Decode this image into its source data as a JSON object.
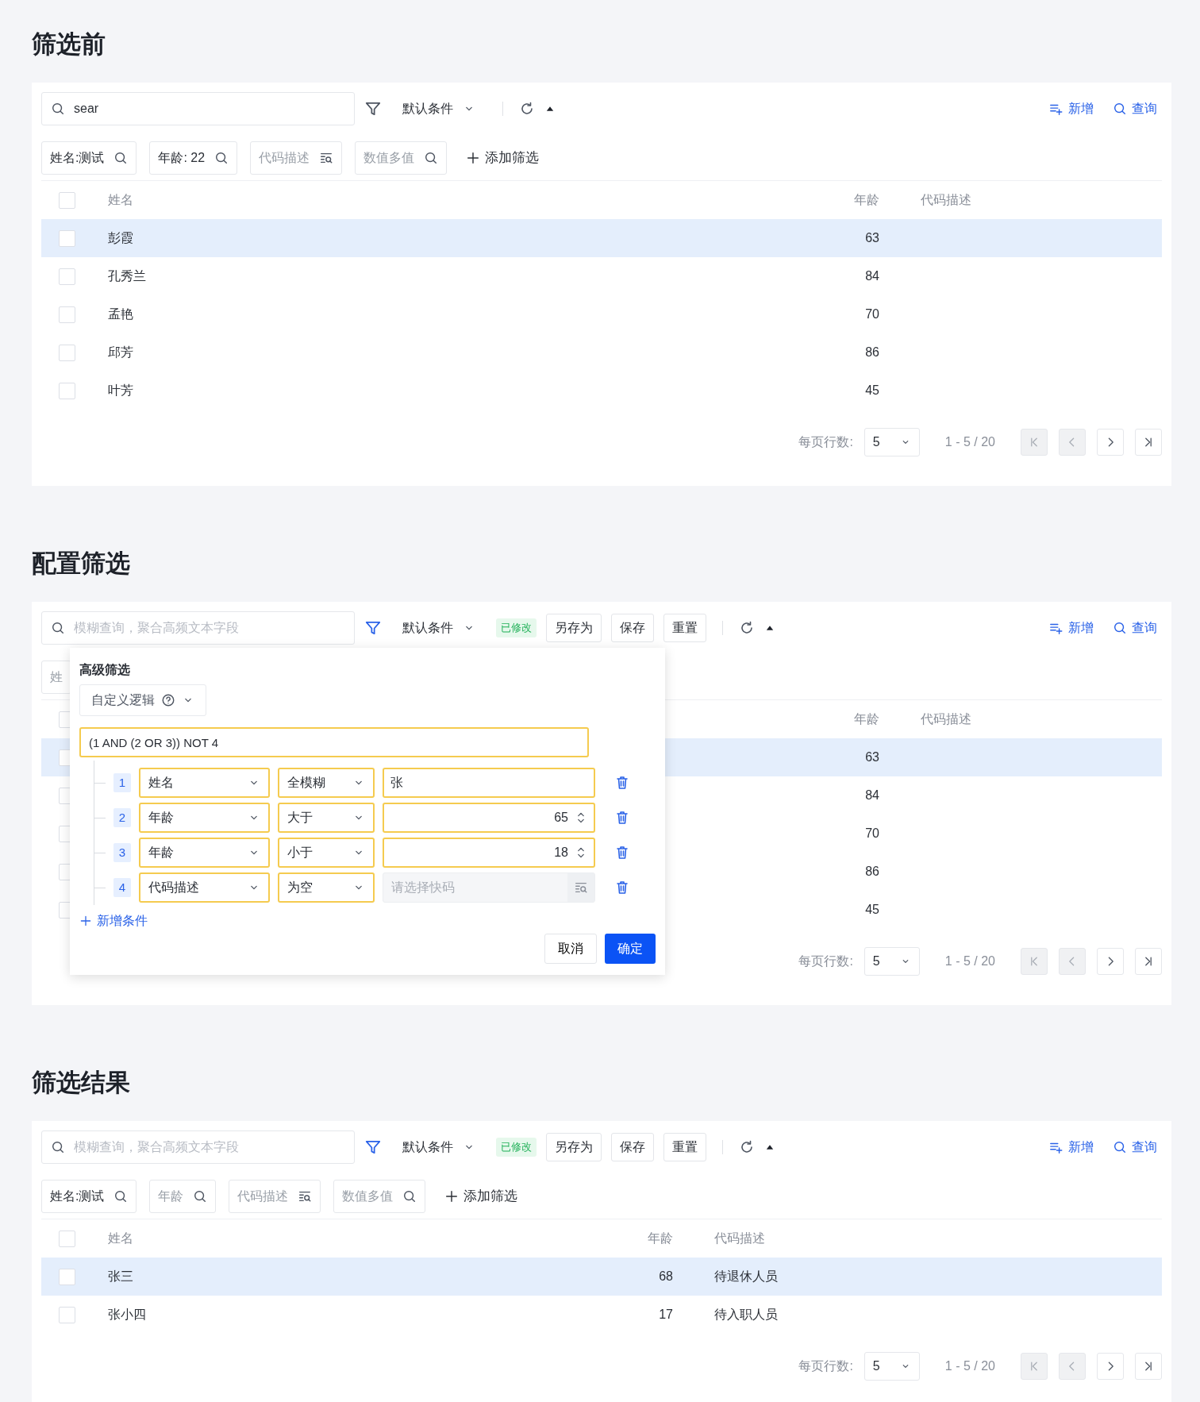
{
  "sections": [
    {
      "title": "筛选前",
      "toolbar": {
        "search": {
          "value": "sear"
        },
        "filter_active": false,
        "condition": "默认条件",
        "actions": [
          {
            "kind": "add",
            "label": "新增"
          },
          {
            "kind": "query",
            "label": "查询"
          }
        ]
      },
      "chips": [
        {
          "text": "姓名:测试",
          "filled": true,
          "kind": "search"
        },
        {
          "text": "年龄: 22",
          "filled": true,
          "kind": "search"
        },
        {
          "text": "代码描述",
          "filled": false,
          "kind": "lookup"
        },
        {
          "text": "数值多值",
          "filled": false,
          "kind": "search"
        }
      ],
      "add_filter": "添加筛选",
      "table": {
        "columns": [
          {
            "kind": "name",
            "label": "姓名"
          },
          {
            "kind": "age",
            "label": "年龄"
          },
          {
            "kind": "desc",
            "label": "代码描述"
          }
        ],
        "all_checked": false,
        "rows": [
          {
            "name": "彭霞",
            "age": "63",
            "selected": true,
            "checked": false
          },
          {
            "name": "孔秀兰",
            "age": "84",
            "selected": false,
            "checked": false
          },
          {
            "name": "孟艳",
            "age": "70",
            "selected": false,
            "checked": false
          },
          {
            "name": "邱芳",
            "age": "86",
            "selected": false,
            "checked": false
          },
          {
            "name": "叶芳",
            "age": "45",
            "selected": false,
            "checked": false
          }
        ]
      },
      "pagination": {
        "rows_label": "每页行数:",
        "page_size": "5",
        "range": "1 - 5 / 20",
        "nav": [
          {
            "kind": "first",
            "disabled": true
          },
          {
            "kind": "prev",
            "disabled": true
          },
          {
            "kind": "next",
            "disabled": false
          },
          {
            "kind": "last",
            "disabled": false
          }
        ]
      }
    },
    {
      "title": "配置筛选",
      "toolbar": {
        "search": {
          "placeholder": "模糊查询，聚合高频文本字段"
        },
        "filter_active": true,
        "condition": "默认条件",
        "modified_tag": "已修改",
        "buttons": [
          "另存为",
          "保存",
          "重置"
        ],
        "actions": [
          {
            "kind": "add",
            "label": "新增"
          },
          {
            "kind": "query",
            "label": "查询"
          }
        ]
      },
      "chips": [
        {
          "text": "姓",
          "filled": false
        }
      ],
      "table": {
        "columns": [
          {
            "kind": "age",
            "label": "年龄"
          },
          {
            "kind": "desc",
            "label": "代码描述"
          }
        ],
        "all_checked": false,
        "rows": [
          {
            "age": "63",
            "selected": true,
            "checked": false
          },
          {
            "age": "84",
            "selected": false,
            "checked": false
          },
          {
            "age": "70",
            "selected": false,
            "checked": false
          },
          {
            "age": "86",
            "selected": false,
            "checked": false
          },
          {
            "age": "45",
            "selected": false,
            "checked": false
          }
        ]
      },
      "pagination": {
        "rows_label": "每页行数:",
        "page_size": "5",
        "range": "1 - 5 / 20",
        "nav": [
          {
            "kind": "first",
            "disabled": true
          },
          {
            "kind": "prev",
            "disabled": true
          },
          {
            "kind": "next",
            "disabled": false
          },
          {
            "kind": "last",
            "disabled": false
          }
        ]
      },
      "advanced_filter": {
        "title": "高级筛选",
        "logic_mode": "自定义逻辑",
        "expression": "(1 AND (2 OR 3)) NOT 4",
        "conditions": [
          {
            "index": "1",
            "field": "姓名",
            "operator": "全模糊",
            "kind": "text",
            "value": "张"
          },
          {
            "index": "2",
            "field": "年龄",
            "operator": "大于",
            "kind": "number",
            "value": "65"
          },
          {
            "index": "3",
            "field": "年龄",
            "operator": "小于",
            "kind": "number",
            "value": "18"
          },
          {
            "index": "4",
            "field": "代码描述",
            "operator": "为空",
            "kind": "lookup",
            "placeholder": "请选择快码"
          }
        ],
        "add_condition": "新增条件",
        "buttons": [
          {
            "kind": "cancel",
            "label": "取消"
          },
          {
            "kind": "confirm",
            "label": "确定"
          }
        ]
      }
    },
    {
      "title": "筛选结果",
      "toolbar": {
        "search": {
          "placeholder": "模糊查询，聚合高频文本字段"
        },
        "filter_active": true,
        "condition": "默认条件",
        "modified_tag": "已修改",
        "buttons": [
          "另存为",
          "保存",
          "重置"
        ],
        "actions": [
          {
            "kind": "add",
            "label": "新增"
          },
          {
            "kind": "query",
            "label": "查询"
          }
        ]
      },
      "chips": [
        {
          "text": "姓名:测试",
          "filled": true,
          "kind": "search"
        },
        {
          "text": "年龄",
          "filled": false,
          "kind": "search"
        },
        {
          "text": "代码描述",
          "filled": false,
          "kind": "lookup"
        },
        {
          "text": "数值多值",
          "filled": false,
          "kind": "search"
        }
      ],
      "add_filter": "添加筛选",
      "table": {
        "columns": [
          {
            "kind": "name",
            "label": "姓名"
          },
          {
            "kind": "age",
            "label": "年龄"
          },
          {
            "kind": "desc",
            "label": "代码描述"
          }
        ],
        "all_checked": false,
        "rows": [
          {
            "name": "张三",
            "age": "68",
            "desc": "待退休人员",
            "selected": true,
            "checked": false
          },
          {
            "name": "张小四",
            "age": "17",
            "desc": "待入职人员",
            "selected": false,
            "checked": false
          }
        ]
      },
      "pagination": {
        "rows_label": "每页行数:",
        "page_size": "5",
        "range": "1 - 5 / 20",
        "nav": [
          {
            "kind": "first",
            "disabled": true
          },
          {
            "kind": "prev",
            "disabled": true
          },
          {
            "kind": "next",
            "disabled": false
          },
          {
            "kind": "last",
            "disabled": false
          }
        ]
      }
    }
  ]
}
